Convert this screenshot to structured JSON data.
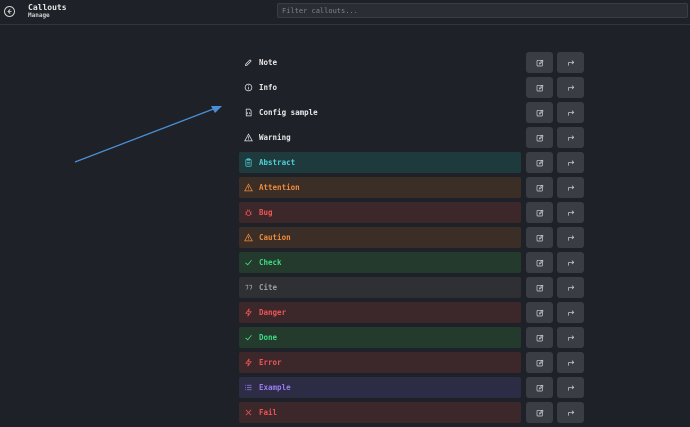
{
  "header": {
    "title": "Callouts",
    "subtitle": "Manage",
    "filter_placeholder": "Filter callouts..."
  },
  "callouts": [
    {
      "label": "Note",
      "icon": "pencil-icon",
      "color": "#e8e8e8",
      "bg": "transparent"
    },
    {
      "label": "Info",
      "icon": "info-icon",
      "color": "#e8e8e8",
      "bg": "transparent"
    },
    {
      "label": "Config sample",
      "icon": "file-code-icon",
      "color": "#e8e8e8",
      "bg": "transparent"
    },
    {
      "label": "Warning",
      "icon": "alert-triangle-icon",
      "color": "#e8e8e8",
      "bg": "transparent"
    },
    {
      "label": "Abstract",
      "icon": "clipboard-icon",
      "color": "#4fd1d9",
      "bg": "#1f3a3d"
    },
    {
      "label": "Attention",
      "icon": "alert-triangle-icon",
      "color": "#f08c3c",
      "bg": "#3a2e27"
    },
    {
      "label": "Bug",
      "icon": "bug-icon",
      "color": "#f05454",
      "bg": "#3c272b"
    },
    {
      "label": "Caution",
      "icon": "alert-triangle-icon",
      "color": "#f08c3c",
      "bg": "#3a2e27"
    },
    {
      "label": "Check",
      "icon": "check-icon",
      "color": "#3ddc84",
      "bg": "#233a2d"
    },
    {
      "label": "Cite",
      "icon": "quote-icon",
      "color": "#a0a0a0",
      "bg": "#2e3034"
    },
    {
      "label": "Danger",
      "icon": "zap-icon",
      "color": "#f05454",
      "bg": "#3c272b"
    },
    {
      "label": "Done",
      "icon": "check-icon",
      "color": "#3ddc84",
      "bg": "#233a2d"
    },
    {
      "label": "Error",
      "icon": "zap-icon",
      "color": "#f05454",
      "bg": "#3c272b"
    },
    {
      "label": "Example",
      "icon": "list-icon",
      "color": "#9a7cf0",
      "bg": "#2d2c45"
    },
    {
      "label": "Fail",
      "icon": "x-icon",
      "color": "#f05454",
      "bg": "#3c272b"
    }
  ],
  "annotation_arrow_color": "#4a8fd6"
}
